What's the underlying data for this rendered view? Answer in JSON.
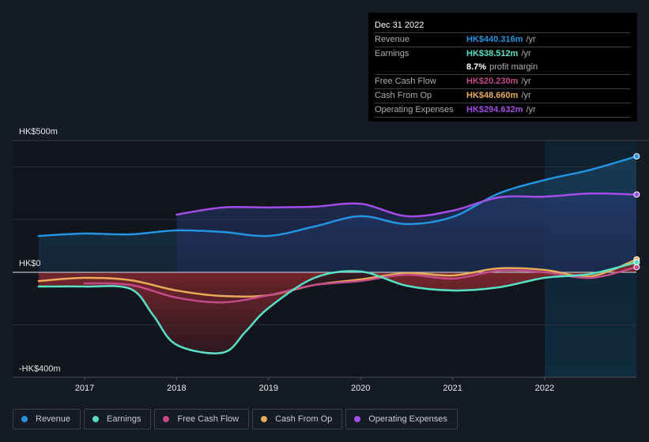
{
  "tooltip": {
    "date": "Dec 31 2022",
    "rows": [
      {
        "label": "Revenue",
        "value": "HK$440.316m",
        "unit": "/yr",
        "color": "#2394df"
      },
      {
        "label": "Earnings",
        "value": "HK$38.512m",
        "unit": "/yr",
        "color": "#58e0c6"
      },
      {
        "label": "",
        "value": "8.7%",
        "unit": "profit margin",
        "color": "#ffffff"
      },
      {
        "label": "Free Cash Flow",
        "value": "HK$20.230m",
        "unit": "/yr",
        "color": "#c54a8a"
      },
      {
        "label": "Cash From Op",
        "value": "HK$48.660m",
        "unit": "/yr",
        "color": "#e8ab5a"
      },
      {
        "label": "Operating Expenses",
        "value": "HK$294.632m",
        "unit": "/yr",
        "color": "#a24de8"
      }
    ]
  },
  "chart_data": {
    "type": "line",
    "title": "",
    "xlabel": "",
    "ylabel": "",
    "y_unit": "HK$ millions",
    "ylim": [
      -400,
      500
    ],
    "xlim": [
      2016.0,
      2023.0
    ],
    "y_tick_labels": [
      {
        "value": 500,
        "label": "HK$500m"
      },
      {
        "value": 0,
        "label": "HK$0"
      },
      {
        "value": -400,
        "label": "-HK$400m"
      }
    ],
    "gridlines": [
      400,
      200,
      -200
    ],
    "x_ticks": [
      {
        "value": 2017,
        "label": "2017"
      },
      {
        "value": 2018,
        "label": "2018"
      },
      {
        "value": 2019,
        "label": "2019"
      },
      {
        "value": 2020,
        "label": "2020"
      },
      {
        "value": 2021,
        "label": "2021"
      },
      {
        "value": 2022,
        "label": "2022"
      }
    ],
    "highlight_range": [
      2022.0,
      2023.0
    ],
    "series": [
      {
        "name": "Revenue",
        "color": "#2394df",
        "x": [
          2016.5,
          2017.0,
          2017.5,
          2018.0,
          2018.5,
          2019.0,
          2019.5,
          2020.0,
          2020.5,
          2021.0,
          2021.5,
          2022.0,
          2022.5,
          2023.0
        ],
        "values": [
          138,
          147,
          144,
          159,
          153,
          138,
          174,
          213,
          183,
          210,
          299,
          350,
          389,
          440
        ]
      },
      {
        "name": "Operating Expenses",
        "color": "#a24de8",
        "x": [
          2018.0,
          2018.5,
          2019.0,
          2019.5,
          2020.0,
          2020.5,
          2021.0,
          2021.5,
          2022.0,
          2022.5,
          2023.0
        ],
        "values": [
          219,
          246,
          246,
          249,
          260,
          213,
          234,
          284,
          287,
          299,
          295
        ]
      },
      {
        "name": "Earnings",
        "color": "#58e0c6",
        "x": [
          2016.5,
          2017.0,
          2017.5,
          2017.75,
          2018.0,
          2018.5,
          2018.75,
          2019.0,
          2019.5,
          2020.0,
          2020.5,
          2021.0,
          2021.5,
          2022.0,
          2022.5,
          2023.0
        ],
        "values": [
          -54,
          -54,
          -63,
          -165,
          -275,
          -305,
          -225,
          -135,
          -21,
          3,
          -51,
          -69,
          -57,
          -21,
          -6,
          38
        ]
      },
      {
        "name": "Free Cash Flow",
        "color": "#c54a8a",
        "x": [
          2017.0,
          2017.5,
          2018.0,
          2018.5,
          2019.0,
          2019.5,
          2020.0,
          2020.5,
          2021.0,
          2021.5,
          2022.0,
          2022.5,
          2023.0
        ],
        "values": [
          -42,
          -48,
          -96,
          -114,
          -87,
          -48,
          -33,
          -9,
          -24,
          6,
          0,
          -21,
          20
        ]
      },
      {
        "name": "Cash From Op",
        "color": "#e8ab5a",
        "x": [
          2016.5,
          2017.0,
          2017.5,
          2018.0,
          2018.5,
          2019.0,
          2019.5,
          2020.0,
          2020.5,
          2021.0,
          2021.5,
          2022.0,
          2022.5,
          2023.0
        ],
        "values": [
          -33,
          -21,
          -30,
          -69,
          -90,
          -87,
          -48,
          -27,
          -3,
          -12,
          15,
          9,
          -15,
          49
        ]
      }
    ],
    "legend": [
      "Revenue",
      "Earnings",
      "Free Cash Flow",
      "Cash From Op",
      "Operating Expenses"
    ],
    "legend_position": "bottom-left"
  },
  "legend": [
    {
      "label": "Revenue",
      "color": "#2394df"
    },
    {
      "label": "Earnings",
      "color": "#58e0c6"
    },
    {
      "label": "Free Cash Flow",
      "color": "#c54a8a"
    },
    {
      "label": "Cash From Op",
      "color": "#e8ab5a"
    },
    {
      "label": "Operating Expenses",
      "color": "#a24de8"
    }
  ]
}
